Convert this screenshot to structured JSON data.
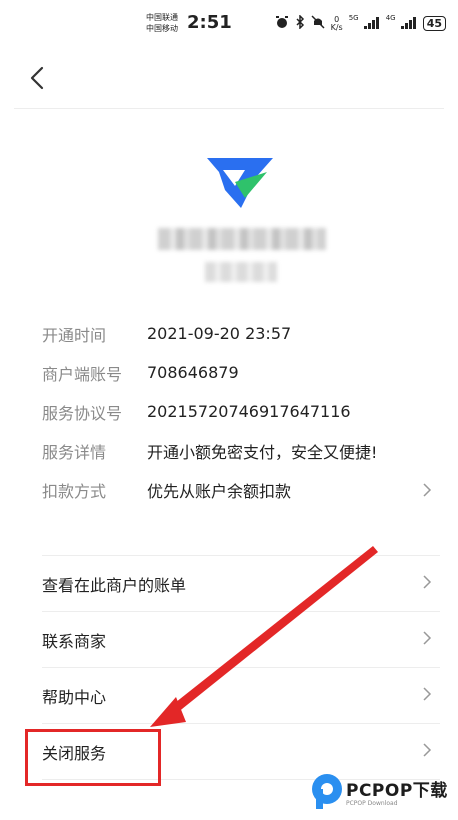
{
  "status_bar": {
    "carrier_1": "中国联通",
    "carrier_2": "中国移动",
    "time": "2:51",
    "net_speed_value": "0",
    "net_speed_unit": "K/s",
    "sig1_label": "5G",
    "sig2_label": "4G",
    "battery": "45"
  },
  "info_rows": [
    {
      "label": "开通时间",
      "value": "2021-09-20 23:57"
    },
    {
      "label": "商户端账号",
      "value": "708646879"
    },
    {
      "label": "服务协议号",
      "value": "20215720746917647116"
    },
    {
      "label": "服务详情",
      "value": "开通小额免密支付，安全又便捷!"
    },
    {
      "label": "扣款方式",
      "value": "优先从账户余额扣款"
    }
  ],
  "actions": [
    {
      "label": "查看在此商户的账单"
    },
    {
      "label": "联系商家"
    },
    {
      "label": "帮助中心"
    },
    {
      "label": "关闭服务"
    }
  ],
  "watermark": {
    "brand": "PCPOP下载",
    "sub": "PCPOP Download"
  },
  "colors": {
    "annotation": "#e32727",
    "logo_blue": "#2a6ff0",
    "logo_green": "#2fc26b"
  }
}
